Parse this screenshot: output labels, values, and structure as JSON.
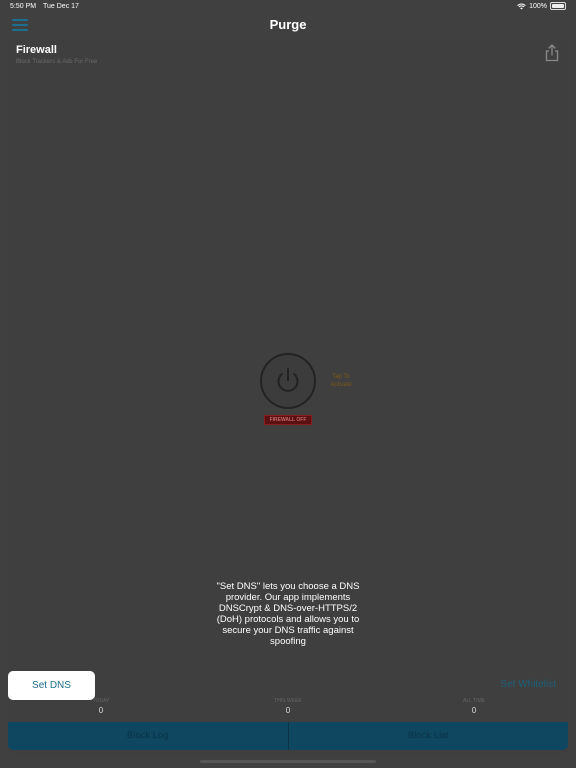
{
  "status_bar": {
    "time": "5:50 PM",
    "date": "Tue Dec 17",
    "battery": "100%"
  },
  "nav": {
    "title": "Purge"
  },
  "card": {
    "title": "Firewall",
    "subtitle": "Block Trackers & Ads For Free"
  },
  "power": {
    "tap_label": "Tap To Activate",
    "status_badge": "FIREWALL OFF"
  },
  "tooltip": {
    "text": "\"Set DNS\" lets you choose a DNS provider.  Our app implements DNSCrypt & DNS-over-HTTPS/2 (DoH) protocols and allows you to secure your DNS traffic against spoofing"
  },
  "actions": {
    "set_dns": "Set DNS",
    "set_whitelist": "Set Whitelist"
  },
  "stats": [
    {
      "label": "TODAY",
      "value": "0"
    },
    {
      "label": "THIS WEEK",
      "value": "0"
    },
    {
      "label": "ALL TIME",
      "value": "0"
    }
  ],
  "bottom_bar": {
    "block_log": "Block Log",
    "block_list": "Block List"
  },
  "colors": {
    "accent": "#1d6f8f",
    "background": "#404040",
    "bottom_bar": "#0f4660",
    "badge": "#5a1111"
  }
}
